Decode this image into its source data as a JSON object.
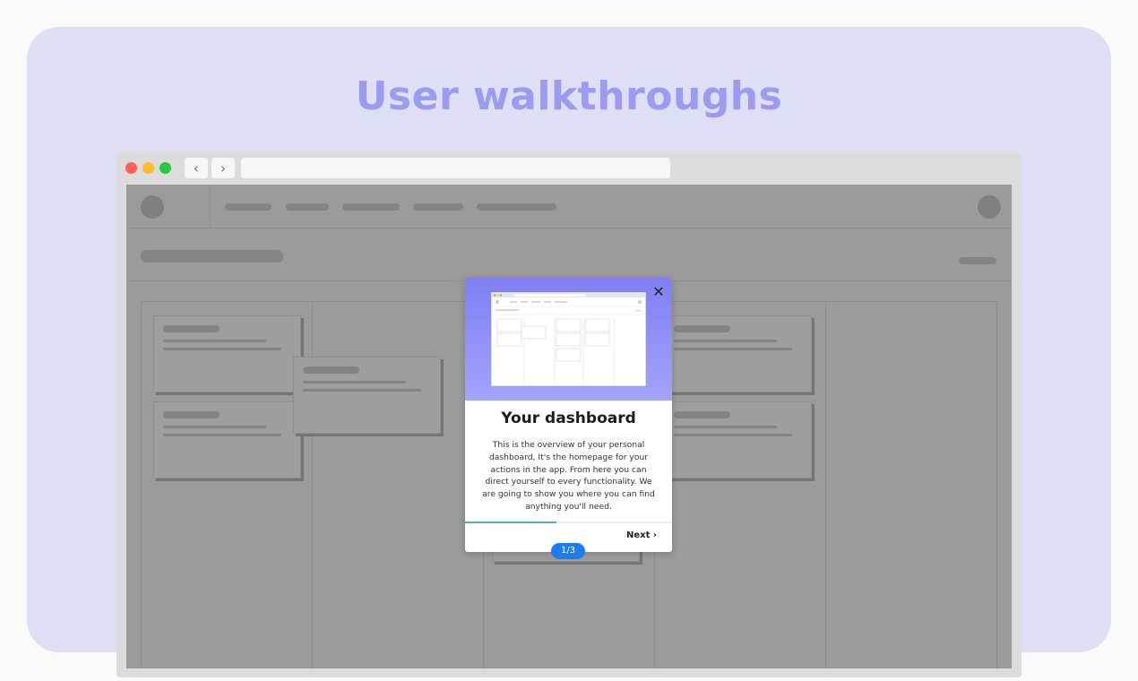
{
  "page": {
    "heading": "User walkthroughs",
    "heading_color": "#9a9cf2",
    "background_panel_color": "#dedef5"
  },
  "browser": {
    "traffic_lights": [
      "#ff5f57",
      "#febc2e",
      "#28c840"
    ],
    "back_icon": "chevron-left-icon",
    "forward_icon": "chevron-right-icon",
    "url": ""
  },
  "walkthrough": {
    "title": "Your dashboard",
    "body": "This is the overview of your personal dashboard, It's the homepage for your actions in the app. From here you can direct yourself to every functionality. We are going to show you where you can find anything you'll need.",
    "next_label": "Next ›",
    "step_label": "1/3",
    "step_current": 1,
    "step_total": 3,
    "progress_fraction": 0.44,
    "close_icon": "close-icon",
    "accent_color": "#1a7ef2",
    "progress_color": "#4fb89a"
  }
}
